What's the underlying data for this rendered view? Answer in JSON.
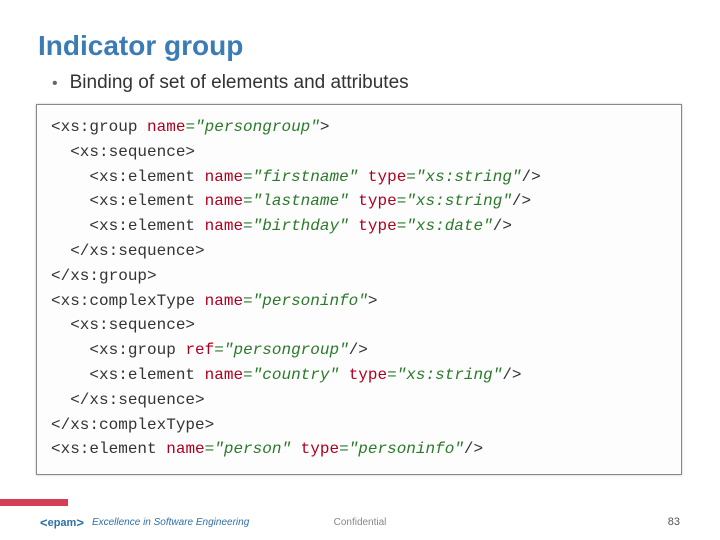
{
  "title": "Indicator group",
  "bullet": "Binding of set of elements and attributes",
  "code": {
    "l1": {
      "t1": "<xs:group",
      "a1": "name",
      "v1": "\"persongroup\"",
      "t2": ">"
    },
    "l2": {
      "t1": "<xs:sequence>"
    },
    "l3": {
      "t1": "<xs:element",
      "a1": "name",
      "v1": "\"firstname\"",
      "a2": "type",
      "v2": "\"xs:string\"",
      "t2": "/>"
    },
    "l4": {
      "t1": "<xs:element",
      "a1": "name",
      "v1": "\"lastname\"",
      "a2": "type",
      "v2": "\"xs:string\"",
      "t2": "/>"
    },
    "l5": {
      "t1": "<xs:element",
      "a1": "name",
      "v1": "\"birthday\"",
      "a2": "type",
      "v2": "\"xs:date\"",
      "t2": "/>"
    },
    "l6": {
      "t1": "</xs:sequence>"
    },
    "l7": {
      "t1": "</xs:group>"
    },
    "l8": {
      "t1": "<xs:complexType",
      "a1": "name",
      "v1": "\"personinfo\"",
      "t2": ">"
    },
    "l9": {
      "t1": "<xs:sequence>"
    },
    "l10": {
      "t1": "<xs:group",
      "a1": "ref",
      "v1": "\"persongroup\"",
      "t2": "/>"
    },
    "l11": {
      "t1": "<xs:element",
      "a1": "name",
      "v1": "\"country\"",
      "a2": "type",
      "v2": "\"xs:string\"",
      "t2": "/>"
    },
    "l12": {
      "t1": "</xs:sequence>"
    },
    "l13": {
      "t1": "</xs:complexType>"
    },
    "l14": {
      "t1": "<xs:element",
      "a1": "name",
      "v1": "\"person\"",
      "a2": "type",
      "v2": "\"personinfo\"",
      "t2": "/>"
    }
  },
  "footer": {
    "logo_text": "epam",
    "tagline": "Excellence in Software Engineering",
    "confidential": "Confidential",
    "page": "83"
  }
}
